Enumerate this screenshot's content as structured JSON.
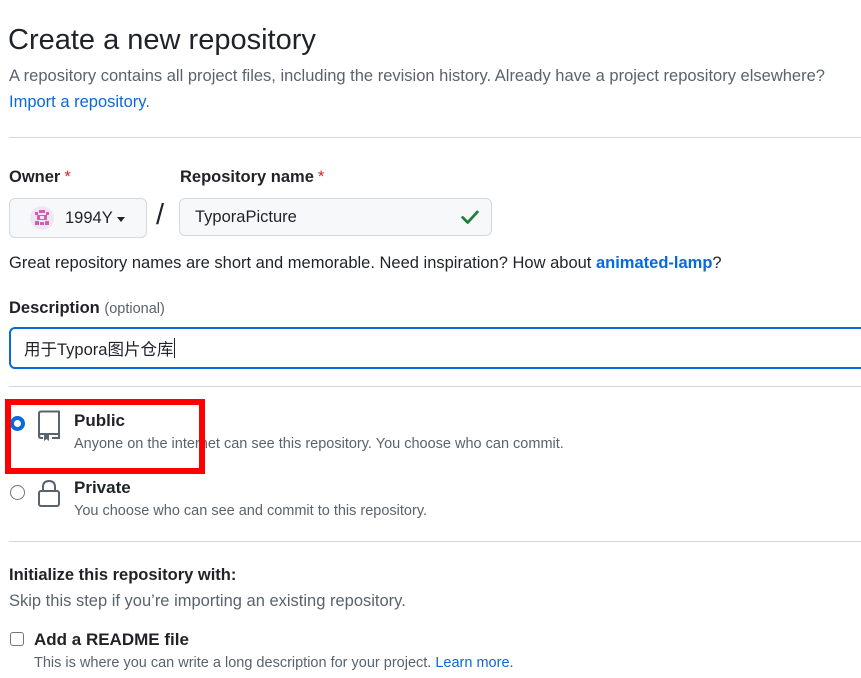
{
  "header": {
    "title": "Create a new repository",
    "subtitle": "A repository contains all project files, including the revision history. Already have a project repository elsewhere?",
    "import_link": "Import a repository",
    "import_suffix": "."
  },
  "owner": {
    "label": "Owner",
    "required_mark": "*",
    "value": "1994Y"
  },
  "repo_name": {
    "label": "Repository name",
    "required_mark": "*",
    "separator": "/",
    "value": "TyporaPicture",
    "valid_icon": "check-icon"
  },
  "hint": {
    "text": "Great repository names are short and memorable. Need inspiration? How about ",
    "suggestion": "animated-lamp",
    "suffix": "?"
  },
  "description": {
    "label": "Description",
    "optional": "(optional)",
    "value": "用于Typora图片仓库"
  },
  "visibility": {
    "options": [
      {
        "title": "Public",
        "desc": "Anyone on the internet can see this repository. You choose who can commit.",
        "icon": "repo-icon",
        "selected": true
      },
      {
        "title": "Private",
        "desc": "You choose who can see and commit to this repository.",
        "icon": "lock-icon",
        "selected": false
      }
    ]
  },
  "initialize": {
    "title": "Initialize this repository with:",
    "subtitle": "Skip this step if you’re importing an existing repository.",
    "readme": {
      "label": "Add a README file",
      "desc": "This is where you can write a long description for your project. ",
      "link": "Learn more.",
      "checked": false
    }
  },
  "colors": {
    "accent": "#0969da",
    "success": "#1a7f37",
    "required": "#d1242f",
    "annotation": "#ff0000"
  }
}
